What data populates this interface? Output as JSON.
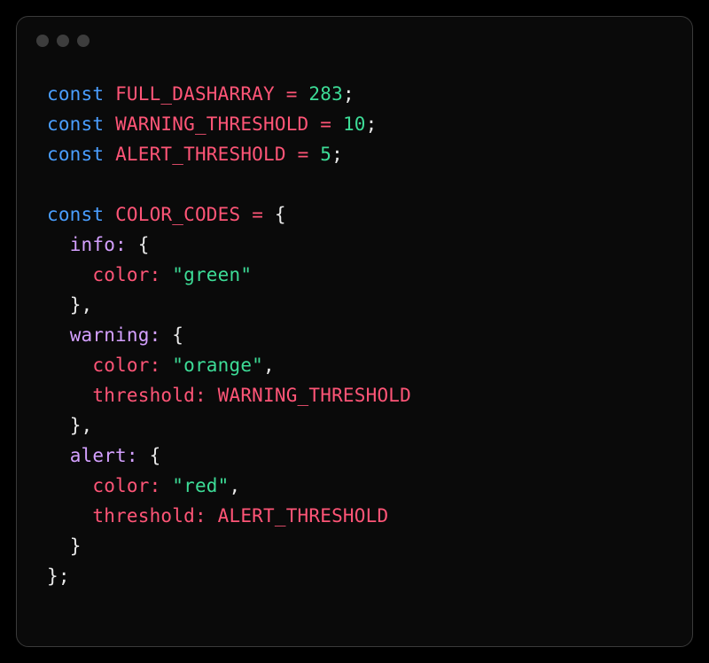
{
  "tokens": {
    "kw_const": "const",
    "full_dasharray": "FULL_DASHARRAY",
    "eq": "=",
    "val_283": "283",
    "semi": ";",
    "warning_threshold": "WARNING_THRESHOLD",
    "val_10": "10",
    "alert_threshold": "ALERT_THRESHOLD",
    "val_5": "5",
    "color_codes": "COLOR_CODES",
    "lbrace": "{",
    "rbrace": "}",
    "comma": ",",
    "info_key": "info:",
    "color_key": "color:",
    "green_str": "\"green\"",
    "warning_key": "warning:",
    "orange_str": "\"orange\"",
    "threshold_key": "threshold:",
    "alert_key": "alert:",
    "red_str": "\"red\""
  }
}
